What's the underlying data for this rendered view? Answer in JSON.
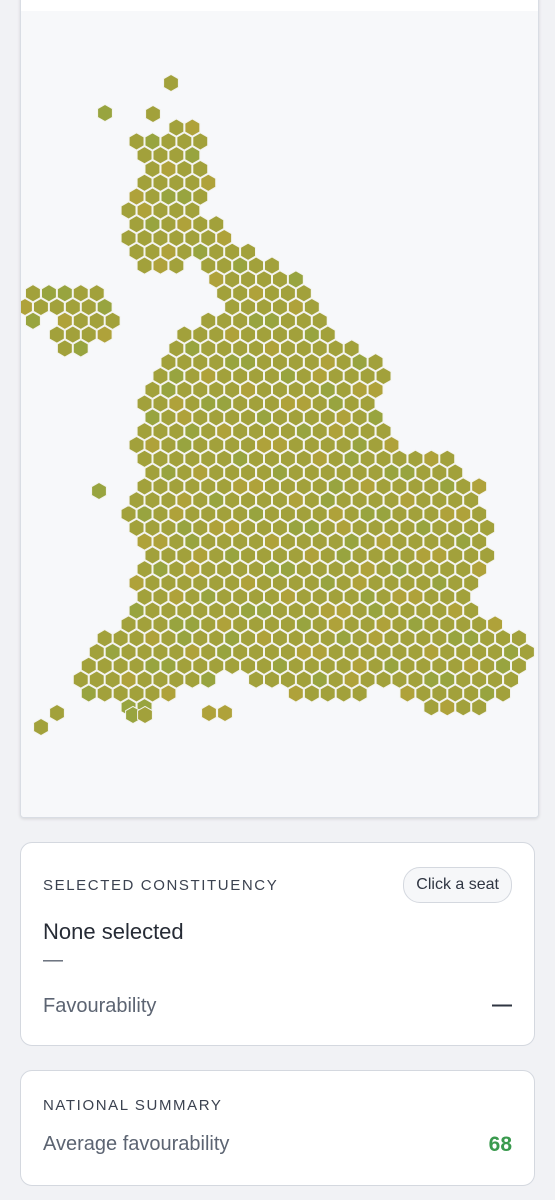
{
  "colors": {
    "hex_base": "#a2a13b",
    "hex_green": "#98a43f",
    "hex_orange": "#afa23a",
    "hex_stroke": "#f3f3ee",
    "map_background": "#f7f8fa",
    "accent_green": "#3a9a4e"
  },
  "selected_panel": {
    "heading": "SELECTED CONSTITUENCY",
    "badge": "Click a seat",
    "name": "None selected",
    "subtitle": "—",
    "favourability_label": "Favourability",
    "favourability_value": "—"
  },
  "summary_panel": {
    "heading": "NATIONAL SUMMARY",
    "average_label": "Average favourability",
    "average_value": "68"
  }
}
